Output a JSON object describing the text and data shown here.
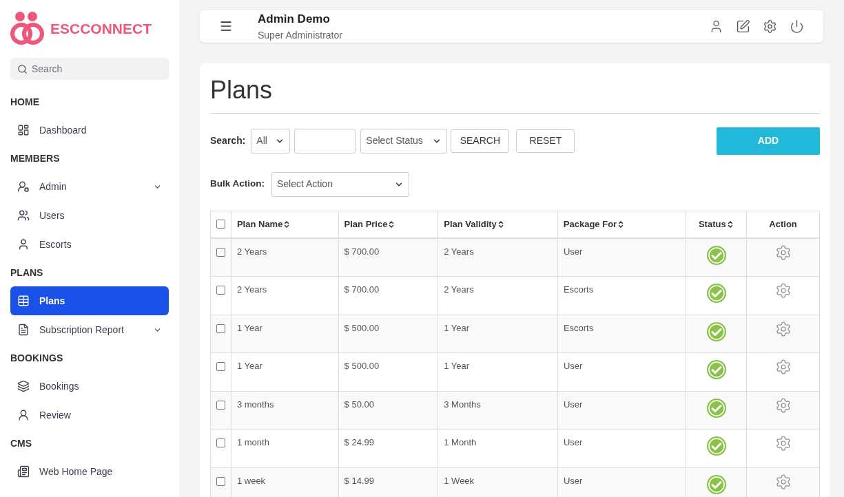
{
  "brand": {
    "name": "ESCCONNECT"
  },
  "sidebar": {
    "search": {
      "placeholder": "Search"
    },
    "sections": [
      {
        "title": "HOME",
        "items": [
          {
            "label": "Dashboard",
            "selected": false,
            "has_submenu": false
          }
        ]
      },
      {
        "title": "MEMBERS",
        "items": [
          {
            "label": "Admin",
            "selected": false,
            "has_submenu": true
          },
          {
            "label": "Users",
            "selected": false,
            "has_submenu": false
          },
          {
            "label": "Escorts",
            "selected": false,
            "has_submenu": false
          }
        ]
      },
      {
        "title": "PLANS",
        "items": [
          {
            "label": "Plans",
            "selected": true,
            "has_submenu": false
          },
          {
            "label": "Subscription Report",
            "selected": false,
            "has_submenu": true
          }
        ]
      },
      {
        "title": "BOOKINGS",
        "items": [
          {
            "label": "Bookings",
            "selected": false,
            "has_submenu": false
          },
          {
            "label": "Review",
            "selected": false,
            "has_submenu": false
          }
        ]
      },
      {
        "title": "CMS",
        "items": [
          {
            "label": "Web Home Page",
            "selected": false,
            "has_submenu": false
          }
        ]
      }
    ]
  },
  "header": {
    "user_name": "Admin Demo",
    "user_role": "Super Administrator"
  },
  "page": {
    "title": "Plans",
    "search": {
      "label": "Search:",
      "field_select": "All",
      "status_select": "Select Status",
      "search_button": "SEARCH",
      "reset_button": "RESET"
    },
    "add_button": "ADD",
    "bulk_action": {
      "label": "Bulk Action:",
      "select": "Select Action"
    },
    "table": {
      "columns": [
        "Plan Name",
        "Plan Price",
        "Plan Validity",
        "Package For",
        "Status",
        "Action"
      ],
      "all_checked": false,
      "rows": [
        {
          "name": "2 Years",
          "price": "$ 700.00",
          "validity": "2 Years",
          "package_for": "User",
          "active": true,
          "checked": false
        },
        {
          "name": "2 Years",
          "price": "$ 700.00",
          "validity": "2 Years",
          "package_for": "Escorts",
          "active": true,
          "checked": false
        },
        {
          "name": "1 Year",
          "price": "$ 500.00",
          "validity": "1 Year",
          "package_for": "Escorts",
          "active": true,
          "checked": false
        },
        {
          "name": "1 Year",
          "price": "$ 500.00",
          "validity": "1 Year",
          "package_for": "User",
          "active": true,
          "checked": false
        },
        {
          "name": "3 months",
          "price": "$ 50.00",
          "validity": "3 Months",
          "package_for": "User",
          "active": true,
          "checked": false
        },
        {
          "name": "1 month",
          "price": "$ 24.99",
          "validity": "1 Month",
          "package_for": "User",
          "active": true,
          "checked": false
        },
        {
          "name": "1 week",
          "price": "$ 14.99",
          "validity": "1 Week",
          "package_for": "User",
          "active": true,
          "checked": false
        }
      ]
    }
  }
}
